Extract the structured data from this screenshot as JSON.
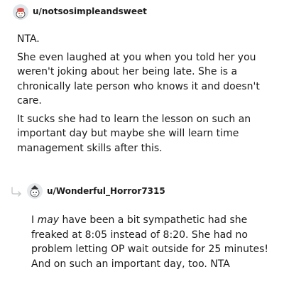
{
  "comment1": {
    "username": "u/notsosimpleandsweet",
    "separator": "·",
    "avatar_icon": "snoo-avatar-icon",
    "paragraphs": [
      "NTA.",
      "She even laughed at you when you told her you weren't joking about her being late. She is a chronically late person who knows it and doesn't care.",
      "It sucks she had to learn the lesson on such an important day but maybe she will learn time management skills after this."
    ]
  },
  "comment2": {
    "username": "u/Wonderful_Horror7315",
    "separator": "·",
    "avatar_icon": "snoo-avatar-icon",
    "reply_icon": "reply-arrow-icon",
    "text_before": "I ",
    "text_emphasis": "may",
    "text_after": " have been a bit sympathetic had she freaked at 8:05 instead of 8:20. She had no problem letting OP wait outside for 25 minutes! And on such an important day, too. NTA"
  },
  "colors": {
    "text": "#1a1a1b",
    "meta": "#878a8c",
    "reply_line": "#c9cbcd"
  }
}
